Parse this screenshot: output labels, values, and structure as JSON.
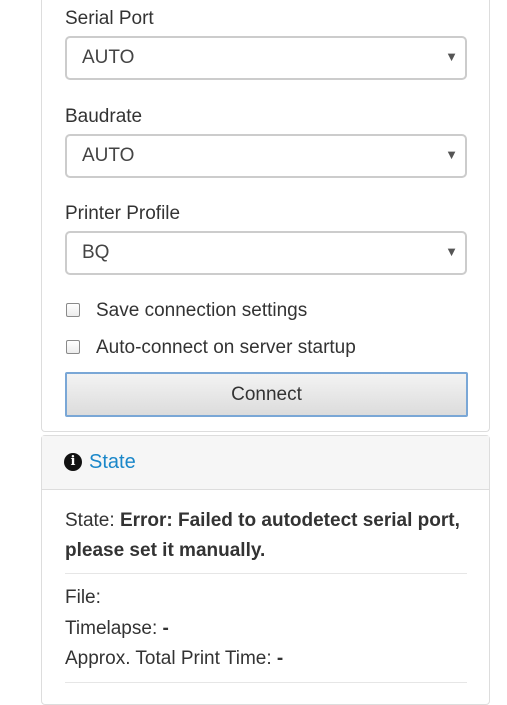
{
  "connection": {
    "serial_port": {
      "label": "Serial Port",
      "value": "AUTO"
    },
    "baudrate": {
      "label": "Baudrate",
      "value": "AUTO"
    },
    "printer_profile": {
      "label": "Printer Profile",
      "value": "BQ"
    },
    "save_settings": {
      "label": "Save connection settings",
      "checked": false
    },
    "auto_connect": {
      "label": "Auto-connect on server startup",
      "checked": false
    },
    "connect_label": "Connect"
  },
  "state_panel": {
    "title": "State",
    "state_label": "State:",
    "state_value": "Error: Failed to autodetect serial port, please set it manually.",
    "file_label": "File:",
    "file_value": "",
    "timelapse_label": "Timelapse:",
    "timelapse_value": "-",
    "total_time_label": "Approx. Total Print Time:",
    "total_time_value": "-"
  },
  "icons": {
    "info": "info-circle-icon",
    "caret": "caret-down-icon"
  },
  "colors": {
    "link": "#1a87c9",
    "button_border": "#7aa7d6",
    "panel_border": "#dddddd"
  }
}
